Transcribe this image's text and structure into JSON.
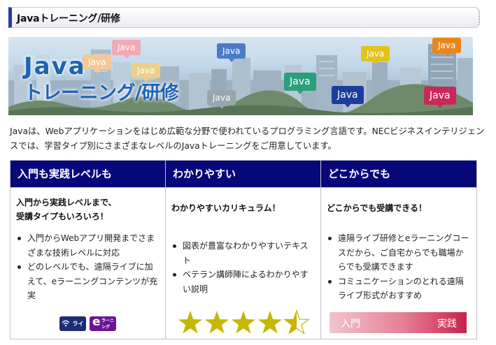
{
  "header": {
    "title": "Javaトレーニング/研修"
  },
  "banner": {
    "title_line1": "Java",
    "title_line2": "トレーニング/研修",
    "bubbles": [
      {
        "label": "Java",
        "color": "#f2a8b6"
      },
      {
        "label": "Java",
        "color": "#f6c896"
      },
      {
        "label": "Java",
        "color": "#ecd08a"
      },
      {
        "label": "Java",
        "color": "#4b7dc4"
      },
      {
        "label": "Java",
        "color": "#9aa5ad"
      },
      {
        "label": "Java",
        "color": "#2c9e7c"
      },
      {
        "label": "Java",
        "color": "#1d3d9e"
      },
      {
        "label": "Java",
        "color": "#e3c21a"
      },
      {
        "label": "Java",
        "color": "#e8861d"
      },
      {
        "label": "Java",
        "color": "#c8295a"
      }
    ]
  },
  "intro": {
    "text": "Javaは、Webアプリケーションをはじめ広範な分野で使われているプログラミング言語です。NECビジネスインテリジェンスでは、学習タイプ別にさまざまなレベルのJavaトレーニングをご用意しています。"
  },
  "features": {
    "header_color": "#06087a",
    "columns": [
      {
        "title": "入門も実践レベルも",
        "subtitle_line1": "入門から実践レベルまで、",
        "subtitle_line2": "受講タイプもいろいろ！",
        "bullets": [
          "入門からWebアプリ開発までさまざまな技術レベルに対応",
          "どのレベルでも、遠隔ライブに加えて、eラーニングコンテンツが充実"
        ],
        "badges": [
          {
            "label": "ライブ",
            "icon": "wifi-icon",
            "color": "#1e2c74"
          },
          {
            "label": "ラーニング",
            "icon": "e-letter-icon",
            "color": "#6a1596"
          }
        ]
      },
      {
        "title": "わかりやすい",
        "subtitle": "わかりやすいカリキュラム！",
        "bullets": [
          "図表が豊富なわかりやすいテキスト",
          "ベテラン講師陣によるわかりやすい説明"
        ],
        "rating": 4.5,
        "rating_max": 5,
        "star_color": "#c6b700"
      },
      {
        "title": "どこからでも",
        "subtitle": "どこからでも受講できる！",
        "bullets": [
          "遠隔ライブ研修とeラーニングコースだから、ご自宅からでも職場からでも受講できます",
          "コミュニケーションのとれる遠隔ライブ形式がおすすめ"
        ],
        "level_start": "入門",
        "level_end": "実践"
      }
    ]
  }
}
